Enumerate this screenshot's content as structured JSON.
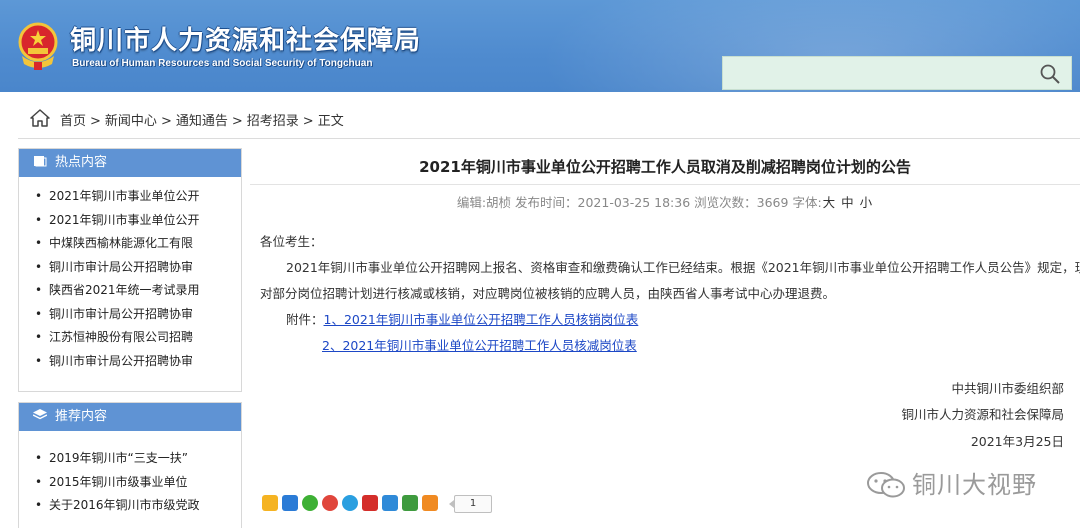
{
  "header": {
    "title_cn": "铜川市人力资源和社会保障局",
    "title_en": "Bureau of Human Resources and Social Security of Tongchuan",
    "search_placeholder": ""
  },
  "breadcrumb": [
    {
      "label": "首页"
    },
    {
      "label": "新闻中心"
    },
    {
      "label": "通知通告"
    },
    {
      "label": "招考招录"
    },
    {
      "label": "正文"
    }
  ],
  "breadcrumb_sep": ">",
  "sidebar": {
    "hot": {
      "title": "热点内容",
      "items": [
        "2021年铜川市事业单位公开",
        "2021年铜川市事业单位公开",
        "中煤陕西榆林能源化工有限",
        "铜川市审计局公开招聘协审",
        "陕西省2021年统一考试录用",
        "铜川市审计局公开招聘协审",
        "江苏恒神股份有限公司招聘",
        "铜川市审计局公开招聘协审"
      ]
    },
    "recommend": {
      "title": "推荐内容",
      "items": [
        "2019年铜川市“三支一扶”",
        "2015年铜川市级事业单位",
        "关于2016年铜川市市级党政"
      ]
    }
  },
  "article": {
    "title": "2021年铜川市事业单位公开招聘工作人员取消及削减招聘岗位计划的公告",
    "meta": {
      "editor_label": "编辑:",
      "editor": "胡桢",
      "published_label": " 发布时间：",
      "published": "2021-03-25 18:36",
      "views_label": " 浏览次数：",
      "views": "3669",
      "fontsize_label": " 字体:",
      "font_large": "大",
      "font_medium": "中",
      "font_small": "小"
    },
    "greeting": "各位考生：",
    "para1_line1": "2021年铜川市事业单位公开招聘网上报名、资格审查和缴费确认工作已经结束。根据《2021年铜川市事业单位公开招聘工作人员公告》规定，现",
    "para1_line2": "对部分岗位招聘计划进行核减或核销，对应聘岗位被核销的应聘人员，由陕西省人事考试中心办理退费。",
    "attachments_label": "附件：",
    "attachment1": "1、2021年铜川市事业单位公开招聘工作人员核销岗位表",
    "attachment2": "2、2021年铜川市事业单位公开招聘工作人员核减岗位表",
    "signature": [
      "中共铜川市委组织部",
      "铜川市人力资源和社会保障局",
      "2021年3月25日"
    ]
  },
  "share": {
    "count": "1",
    "icons": [
      "qzone-icon",
      "qq-icon",
      "wechat-icon",
      "weibo-icon",
      "pengyou-icon",
      "renren-icon",
      "kaixin-icon",
      "douban-icon",
      "more-share-icon"
    ],
    "colors": [
      "#f5b322",
      "#2b7bd6",
      "#3eb035",
      "#e0463c",
      "#2a9fe0",
      "#d42e2a",
      "#2f8ad8",
      "#3f9b3f",
      "#f08a22"
    ]
  },
  "watermark": "铜川大视野"
}
